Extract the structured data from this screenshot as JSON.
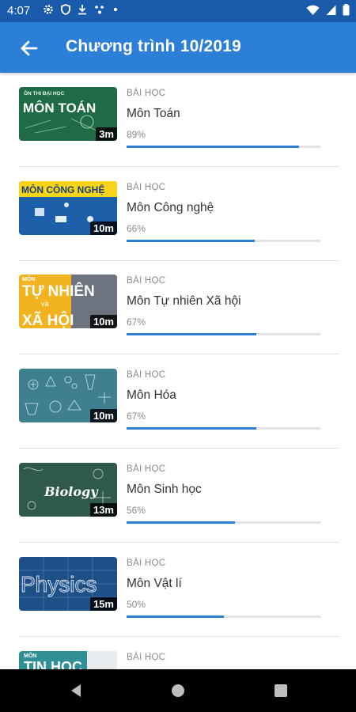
{
  "status_bar": {
    "time": "4:07",
    "icons_left": [
      "gear-icon",
      "shield-icon",
      "download-icon",
      "network-icon",
      "dot-icon"
    ],
    "icons_right": [
      "wifi-icon",
      "signal-icon",
      "battery-icon"
    ]
  },
  "app_bar": {
    "title": "Chương trình 10/2019",
    "back_icon": "arrow-left-icon",
    "color": "#2c7fd6"
  },
  "lessons": [
    {
      "kind": "BÀI HỌC",
      "title": "Môn Toán",
      "percent_label": "89%",
      "progress": 0.89,
      "duration": "3m",
      "thumb": {
        "text_top": "ÔN THI ĐẠI HỌC",
        "text_main": "MÔN TOÁN",
        "bg": "#1f6b46"
      }
    },
    {
      "kind": "BÀI HỌC",
      "title": "Môn Công nghệ",
      "percent_label": "66%",
      "progress": 0.66,
      "duration": "10m",
      "thumb": {
        "text_main": "MÔN CÔNG NGHỆ",
        "bg": "#1d5fa8"
      }
    },
    {
      "kind": "BÀI HỌC",
      "title": "Môn Tự nhiên Xã hội",
      "percent_label": "67%",
      "progress": 0.67,
      "duration": "10m",
      "thumb": {
        "text_top": "MÔN",
        "text_main": "TỰ NHIÊN",
        "text_mid": "và",
        "text_bottom": "XÃ HỘI",
        "bg": "#f2b320"
      }
    },
    {
      "kind": "BÀI HỌC",
      "title": "Môn Hóa",
      "percent_label": "67%",
      "progress": 0.67,
      "duration": "10m",
      "thumb": {
        "bg": "#3e7f90"
      }
    },
    {
      "kind": "BÀI HỌC",
      "title": "Môn Sinh học",
      "percent_label": "56%",
      "progress": 0.56,
      "duration": "13m",
      "thumb": {
        "text_main": "Biology",
        "bg": "#2f5a4a"
      }
    },
    {
      "kind": "BÀI HỌC",
      "title": "Môn Vật lí",
      "percent_label": "50%",
      "progress": 0.5,
      "duration": "15m",
      "thumb": {
        "text_main": "Physics",
        "bg": "#1e4f86"
      }
    },
    {
      "kind": "BÀI HỌC",
      "title": "",
      "percent_label": "",
      "progress": null,
      "duration": "",
      "thumb": {
        "text_top": "MÔN",
        "text_main": "TIN HỌC",
        "bg": "#2f8f95"
      }
    }
  ],
  "nav_bar": {
    "back_icon": "nav-back-icon",
    "home_icon": "nav-home-icon",
    "recents_icon": "nav-recents-icon"
  }
}
